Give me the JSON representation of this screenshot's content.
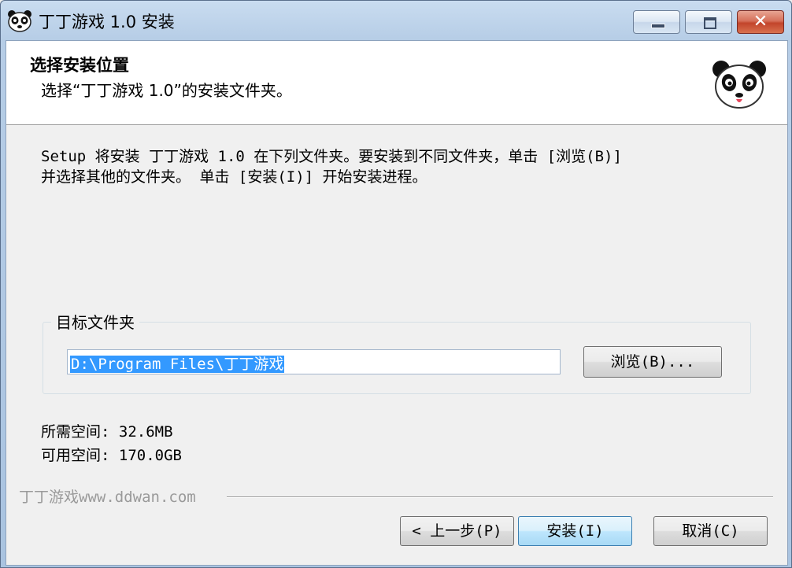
{
  "window": {
    "title": "丁丁游戏 1.0 安装",
    "minimize_label": "",
    "maximize_label": "",
    "close_label": "✕"
  },
  "header": {
    "title": "选择安装位置",
    "subtitle": "选择“丁丁游戏 1.0”的安装文件夹。",
    "logo_icon": "panda-logo-icon"
  },
  "description": {
    "line1": "Setup 将安装 丁丁游戏 1.0 在下列文件夹。要安装到不同文件夹，单击 [浏览(B)]",
    "line2": "并选择其他的文件夹。 单击 [安装(I)] 开始安装进程。"
  },
  "destination": {
    "group_label": "目标文件夹",
    "path_value": "D:\\Program Files\\丁丁游戏",
    "browse_label": "浏览(B)..."
  },
  "space": {
    "required": "所需空间: 32.6MB",
    "available": "可用空间: 170.0GB"
  },
  "footer": {
    "brand": "丁丁游戏www.ddwan.com",
    "back_label": "< 上一步(P)",
    "install_label": "安装(I)",
    "cancel_label": "取消(C)"
  },
  "colors": {
    "selection": "#3399ff",
    "close_button": "#c2442b",
    "default_button_border": "#3c7fb1"
  }
}
